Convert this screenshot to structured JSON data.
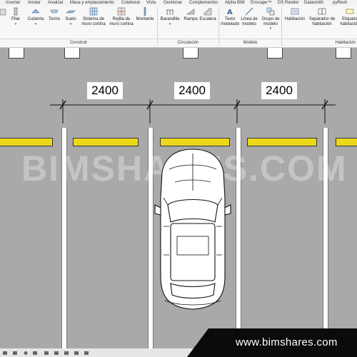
{
  "menu": {
    "tabs": [
      "Insertar",
      "Anotar",
      "Analizar",
      "Masa y emplazamiento",
      "Colaborar",
      "Vista",
      "Gestionar",
      "Complementos",
      "Alpha BIM",
      "Enscape™",
      "DS Render",
      "Datasmith",
      "pyRevit"
    ]
  },
  "ribbon": {
    "construir": [
      "Pilar",
      "Cubierta",
      "Techo",
      "Suelo",
      "Sistema de muro cortina",
      "Rejilla de muro cortina",
      "Montante"
    ],
    "circulacion": [
      "Barandilla",
      "Rampa",
      "Escalera"
    ],
    "modelo": [
      "Texto modelado",
      "Línea de modelo",
      "Grupo de modelo"
    ],
    "habitacion": [
      "Habitación",
      "Separador de habitación",
      "Etiqueta habitación"
    ],
    "groups": {
      "construir": "Construir",
      "circulacion": "Circulación",
      "modelo": "Modelo",
      "habitacion": "Habitación"
    }
  },
  "canvas": {
    "dimensions": [
      "2400",
      "2400",
      "2400"
    ],
    "watermark": "BIMSHARES.COM"
  },
  "banner": {
    "url": "www.bimshares.com"
  },
  "colors": {
    "canvas_bg": "#a9a9a9",
    "wheel_stop": "#ecd81b",
    "banner_bg": "#0b0b0b"
  }
}
